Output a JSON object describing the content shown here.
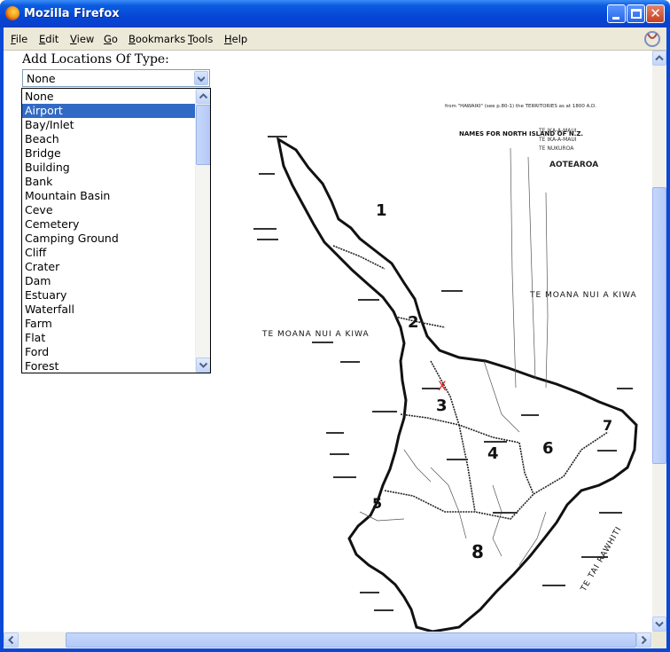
{
  "window": {
    "title": "Mozilla Firefox"
  },
  "menu": {
    "items": [
      "File",
      "Edit",
      "View",
      "Go",
      "Bookmarks",
      "Tools",
      "Help"
    ]
  },
  "form": {
    "label": "Add Locations Of Type:",
    "selected_value": "None",
    "options": [
      "None",
      "Airport",
      "Bay/Inlet",
      "Beach",
      "Bridge",
      "Building",
      "Bank",
      "Mountain Basin",
      "Ceve",
      "Cemetery",
      "Camping Ground",
      "Cliff",
      "Crater",
      "Dam",
      "Estuary",
      "Waterfall",
      "Farm",
      "Flat",
      "Ford",
      "Forest"
    ],
    "highlighted_option": "Airport"
  },
  "map": {
    "header_text": "from \"HAWAIKI\" (see p.80-1) the TERRITORIES as at 1800 A.D.",
    "names_title": "NAMES FOR NORTH ISLAND OF N.Z.",
    "maori_names": [
      "TE IKA-A-MAUI",
      "TE IKA-A-MAUI",
      "TE NUKUROA",
      "AOTEAROA"
    ],
    "sea_labels": [
      "TE MOANA NUI A KIWA",
      "TE MOANA NUI A KIWA",
      "TE TAI RAWHITI"
    ],
    "region_numbers": [
      "1",
      "2",
      "3",
      "4",
      "5",
      "6",
      "7",
      "8"
    ],
    "marker": "X",
    "marker_color": "#e0201c"
  },
  "icons": {
    "app": "firefox-icon",
    "throbber": "throbber-icon"
  }
}
